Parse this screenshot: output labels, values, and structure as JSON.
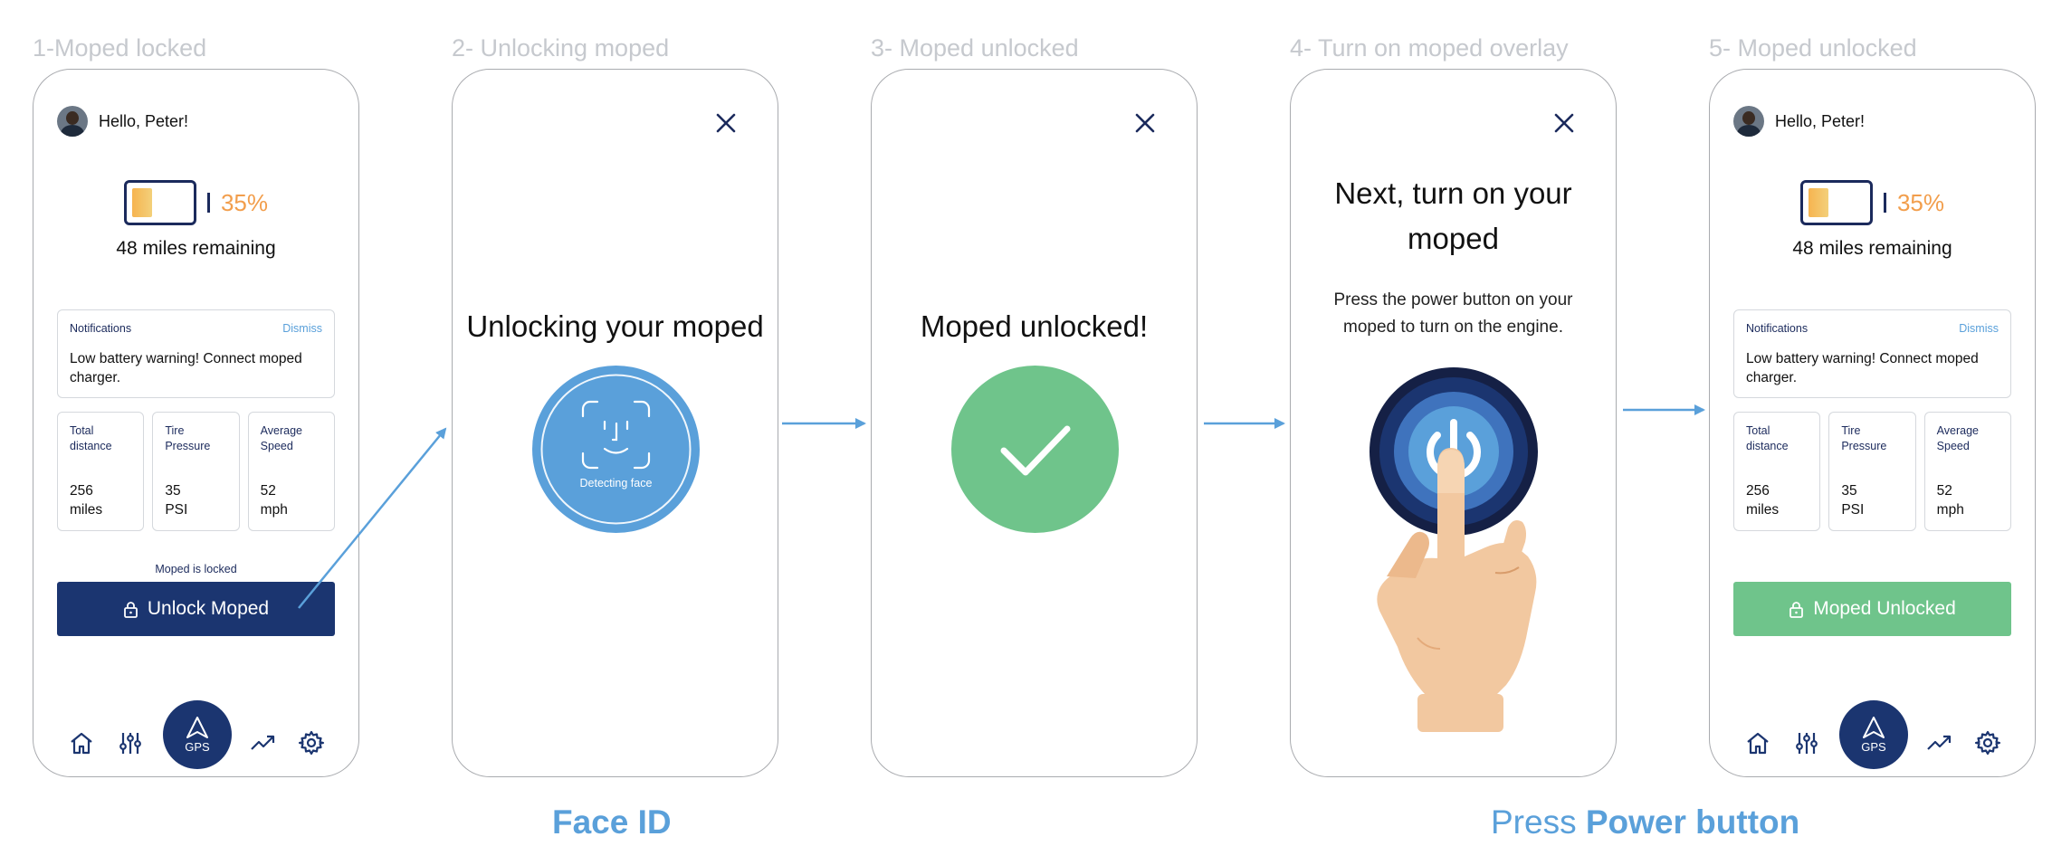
{
  "steps": [
    {
      "label": "1-Moped locked"
    },
    {
      "label": "2- Unlocking moped"
    },
    {
      "label": "3- Moped unlocked"
    },
    {
      "label": "4- Turn on moped overlay"
    },
    {
      "label": "5- Moped unlocked"
    }
  ],
  "dashboard": {
    "greeting": "Hello, Peter!",
    "battery_percent_text": "35%",
    "battery_level": 0.35,
    "miles_remaining": "48 miles remaining",
    "notification": {
      "title": "Notifications",
      "dismiss": "Dismiss",
      "message": "Low battery warning! Connect moped charger."
    },
    "stats": [
      {
        "label": "Total\ndistance",
        "value": "256\nmiles"
      },
      {
        "label": "Tire\nPressure",
        "value": "35\nPSI"
      },
      {
        "label": "Average\nSpeed",
        "value": "52\nmph"
      }
    ],
    "lock_status": "Moped is locked",
    "unlock_button": "Unlock Moped",
    "unlocked_button": "Moped Unlocked",
    "nav": {
      "gps_label": "GPS"
    }
  },
  "unlocking": {
    "title": "Unlocking your moped",
    "face_label": "Detecting face"
  },
  "unlocked": {
    "title": "Moped unlocked!"
  },
  "power": {
    "title_line1": "Next, turn on your",
    "title_line2": "moped",
    "desc_line1": "Press the power button on your",
    "desc_line2": "moped to turn on the engine."
  },
  "captions": {
    "face_id": "Face ID",
    "press": "Press",
    "power_button": "Power button"
  },
  "colors": {
    "navy": "#1b3570",
    "accent_blue": "#5aa0da",
    "success_green": "#6fc48b",
    "battery_orange": "#f29e4c"
  }
}
